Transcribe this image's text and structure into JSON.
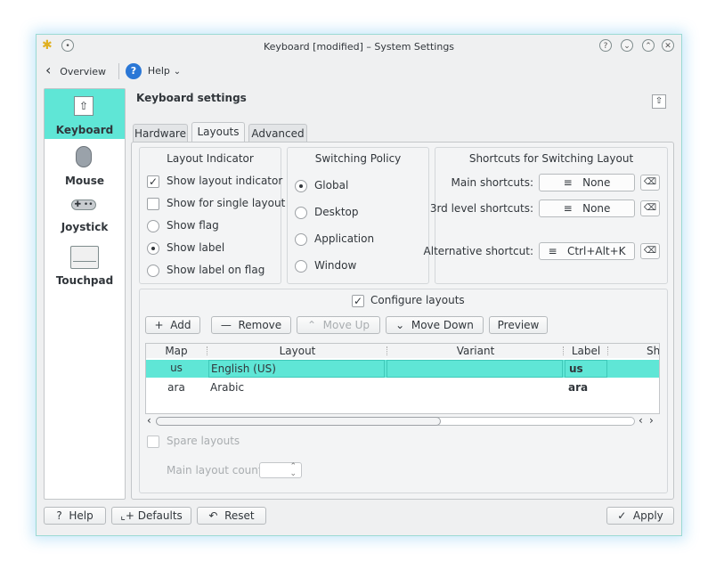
{
  "window": {
    "title": "Keyboard [modified] – System Settings"
  },
  "toolbar": {
    "overview": "Overview",
    "help": "Help"
  },
  "sidebar": {
    "items": [
      {
        "label": "Keyboard",
        "icon": "keyboard-icon"
      },
      {
        "label": "Mouse",
        "icon": "mouse-icon"
      },
      {
        "label": "Joystick",
        "icon": "joystick-icon"
      },
      {
        "label": "Touchpad",
        "icon": "touchpad-icon"
      }
    ]
  },
  "header": {
    "title": "Keyboard settings"
  },
  "tabs": {
    "hardware": "Hardware",
    "layouts": "Layouts",
    "advanced": "Advanced"
  },
  "indicator": {
    "title": "Layout Indicator",
    "show_indicator": "Show layout indicator",
    "single_layout": "Show for single layout",
    "show_flag": "Show flag",
    "show_label": "Show label",
    "label_on_flag": "Show label on flag"
  },
  "policy": {
    "title": "Switching Policy",
    "global": "Global",
    "desktop": "Desktop",
    "application": "Application",
    "window": "Window"
  },
  "shortcuts": {
    "title": "Shortcuts for Switching Layout",
    "main_label": "Main shortcuts:",
    "main_value": "None",
    "third_label": "3rd level shortcuts:",
    "third_value": "None",
    "alt_label": "Alternative shortcut:",
    "alt_value": "Ctrl+Alt+K"
  },
  "layouts": {
    "configure": "Configure layouts",
    "add": "Add",
    "remove": "Remove",
    "move_up": "Move Up",
    "move_down": "Move Down",
    "preview": "Preview",
    "columns": [
      "Map",
      "Layout",
      "Variant",
      "Label",
      "Sh"
    ],
    "rows": [
      {
        "map": "us",
        "layout": "English (US)",
        "variant": "",
        "label": "us"
      },
      {
        "map": "ara",
        "layout": "Arabic",
        "variant": "",
        "label": "ara"
      }
    ],
    "spare": "Spare layouts",
    "main_count": "Main layout count:"
  },
  "bottom": {
    "help": "Help",
    "defaults": "Defaults",
    "reset": "Reset",
    "apply": "Apply"
  },
  "colors": {
    "selection": "#5fe6d6",
    "accent": "#3daee9"
  }
}
